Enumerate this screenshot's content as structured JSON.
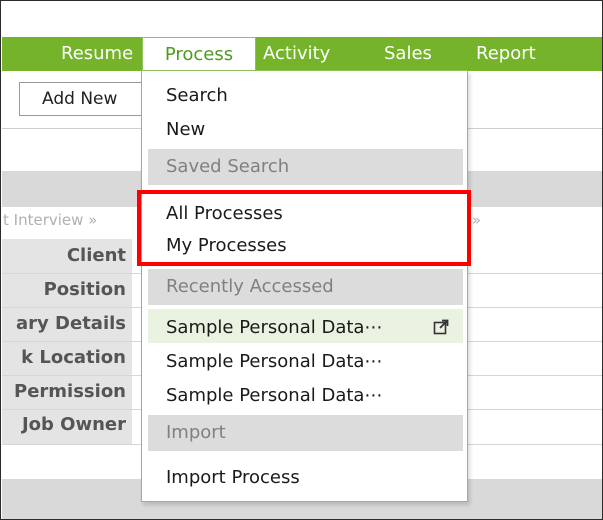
{
  "nav": {
    "items": [
      {
        "label": "Resume"
      },
      {
        "label": "Process"
      },
      {
        "label": "Activity"
      },
      {
        "label": "Sales"
      },
      {
        "label": "Report"
      }
    ],
    "active_index": 1
  },
  "toolbar": {
    "add_new_label": "Add New"
  },
  "breadcrumb": {
    "left": "t Interview »",
    "right": "r »"
  },
  "form": {
    "labels": [
      "Client",
      "Position",
      "ary Details",
      "k Location",
      "Permission",
      "Job Owner"
    ]
  },
  "dropdown": {
    "search": "Search",
    "new": "New",
    "saved_search_header": "Saved Search",
    "all_processes": "All Processes",
    "my_processes": "My Processes",
    "recently_accessed_header": "Recently Accessed",
    "recent_items": [
      "Sample Personal Data⋯",
      "Sample Personal Data⋯",
      "Sample Personal Data⋯"
    ],
    "import_header": "Import",
    "import_process": "Import Process"
  },
  "colors": {
    "nav_green": "#74b32a",
    "highlight_red": "#ff0000",
    "section_gray": "#dcdcdc"
  },
  "icons": {
    "external_link": "external-link-icon"
  }
}
